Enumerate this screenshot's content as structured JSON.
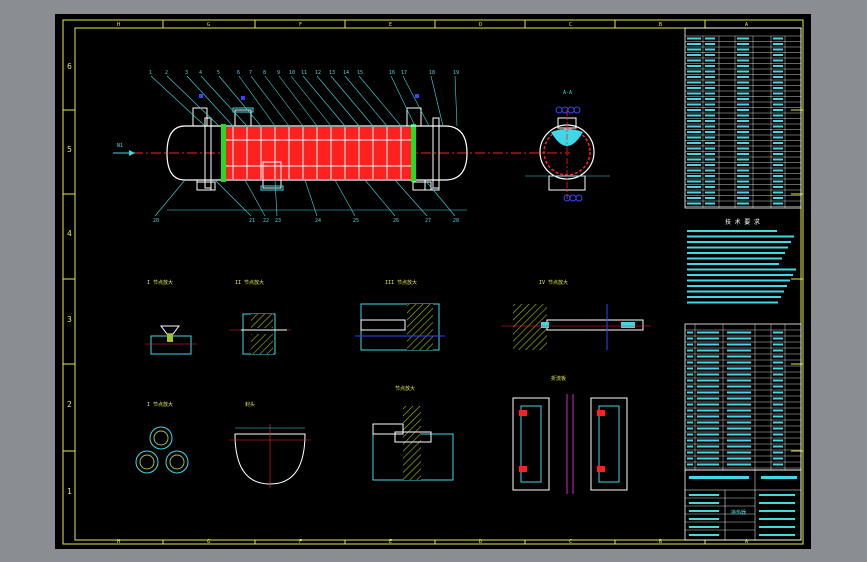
{
  "colors": {
    "background": "#8a8d91",
    "sheet": "#000000",
    "frame": "#e8e84a",
    "line": "#ffffff",
    "cyan": "#3fd8e6",
    "red": "#ff2020",
    "green": "#22dd22",
    "blue": "#3344ff",
    "magenta": "#ff33ff",
    "hatch": "#a8c020"
  },
  "frame": {
    "row_labels": [
      "6",
      "5",
      "4",
      "3",
      "2",
      "1"
    ],
    "col_labels": [
      "H",
      "G",
      "F",
      "E",
      "D",
      "C",
      "B",
      "A"
    ]
  },
  "drawing": {
    "inlet_arrow_label": "N1",
    "cross_section_label": "A-A",
    "detail_titles": [
      "I 节点放大",
      "II 节点放大",
      "III 节点放大",
      "IV 节点放大",
      "I 节点放大",
      "封头",
      "节点放大",
      "折流板"
    ],
    "tech_req_title": "技 术 要 求",
    "title_block_label": "换热器"
  }
}
